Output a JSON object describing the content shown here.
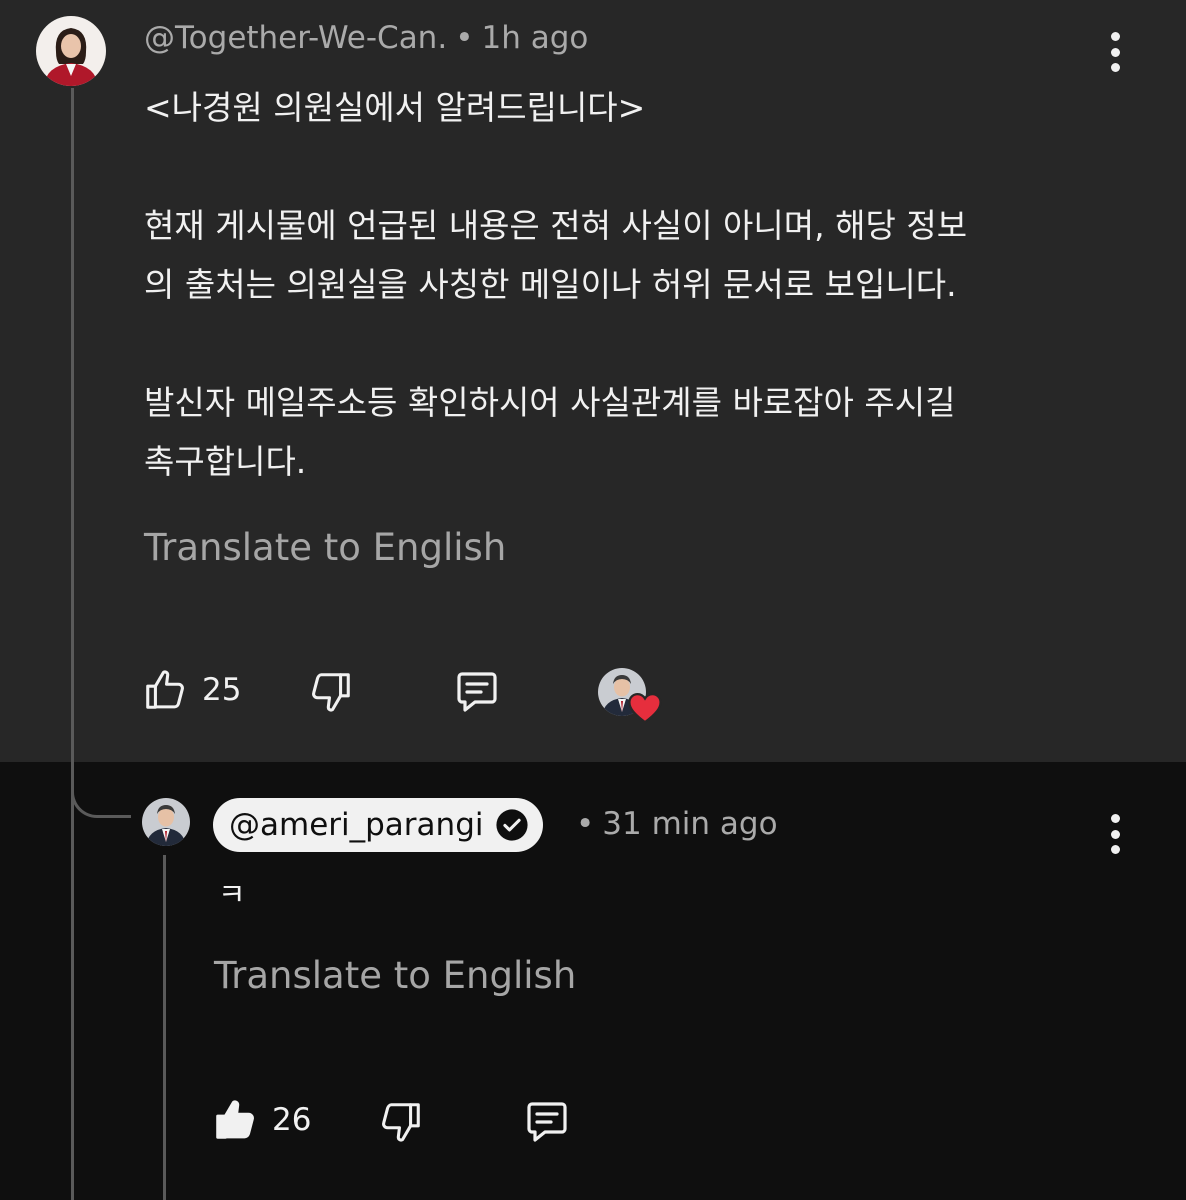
{
  "comment": {
    "author": "@Together-We-Can.",
    "separator": "•",
    "time": "1h ago",
    "body_lines": [
      "<나경원 의원실에서 알려드립니다>",
      "현재 게시물에 언급된 내용은 전혀 사실이 아니며, 해당 정보",
      "의 출처는 의원실을 사칭한 메일이나 허위 문서로 보입니다.",
      "발신자 메일주소등 확인하시어 사실관계를 바로잡아 주시길",
      "촉구합니다."
    ],
    "translate_label": "Translate to English",
    "like_count": "25",
    "colors": {
      "background": "#272727",
      "heart": "#e62e3d"
    }
  },
  "reply": {
    "author": "@ameri_parangi",
    "separator": "•",
    "time": "31 min ago",
    "body": "ㅋ",
    "translate_label": "Translate to English",
    "like_count": "26",
    "colors": {
      "background": "#0f0f0f",
      "pill": "#f1f1f1"
    }
  },
  "icons": [
    "thumbs-up-icon",
    "thumbs-down-icon",
    "reply-icon",
    "more-vertical-icon",
    "verified-check-icon",
    "heart-icon"
  ]
}
